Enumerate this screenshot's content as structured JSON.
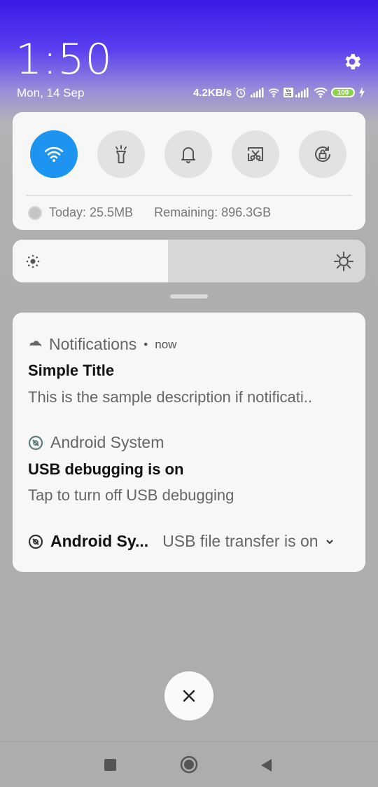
{
  "status": {
    "time": "1:50",
    "date": "Mon, 14 Sep",
    "net_speed": "4.2KB/s",
    "battery": "100"
  },
  "quick_toggles": {
    "items": [
      {
        "icon": "wifi-icon",
        "active": true
      },
      {
        "icon": "flashlight-icon",
        "active": false
      },
      {
        "icon": "bell-icon",
        "active": false
      },
      {
        "icon": "screenshot-icon",
        "active": false
      },
      {
        "icon": "rotation-lock-icon",
        "active": false
      }
    ],
    "usage_today": "Today: 25.5MB",
    "usage_remaining": "Remaining: 896.3GB"
  },
  "brightness": {
    "level": 0.44
  },
  "notifications": [
    {
      "app": "Notifications",
      "time": "now",
      "title": "Simple Title",
      "text": "This is the sample description if notificati.."
    },
    {
      "app": "Android System",
      "title": "USB debugging is on",
      "text": "Tap to turn off USB debugging"
    },
    {
      "app": "Android Sy...",
      "text": "USB file transfer is on"
    }
  ],
  "colors": {
    "accent": "#1d95f0",
    "card": "#f7f7f7"
  }
}
